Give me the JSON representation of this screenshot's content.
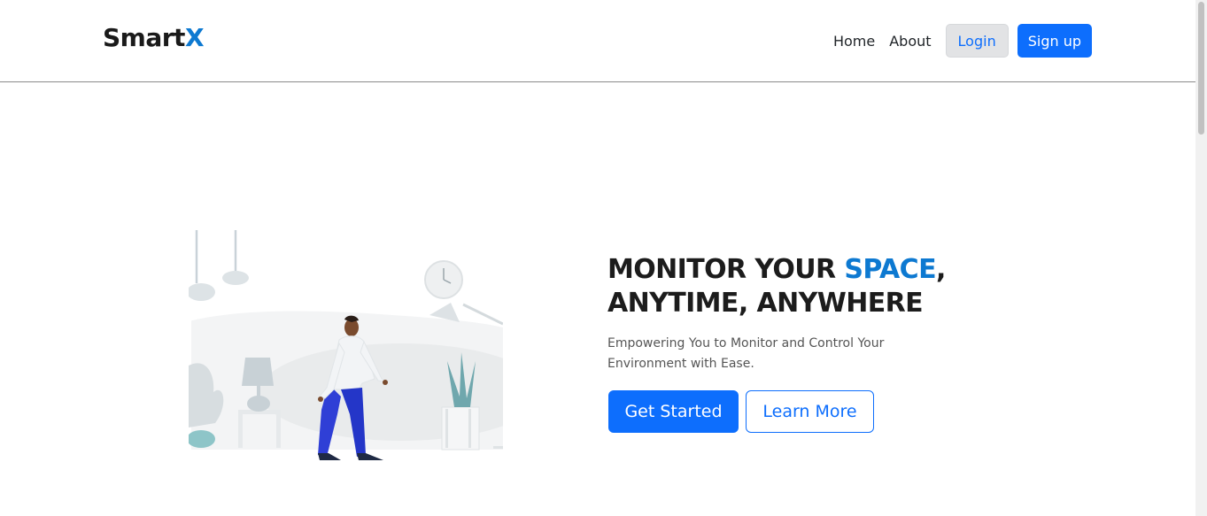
{
  "brand": {
    "name_main": "Smart",
    "name_accent": "X"
  },
  "nav": {
    "home": "Home",
    "about": "About",
    "login": "Login",
    "signup": "Sign up"
  },
  "hero": {
    "title_part1": "MONITOR YOUR ",
    "title_accent": "SPACE",
    "title_part2": ",",
    "title_line2": "ANYTIME, ANYWHERE",
    "subtitle": "Empowering You to Monitor and Control Your Environment with Ease.",
    "primary_button": "Get Started",
    "secondary_button": "Learn More",
    "illustration_icon": "person-walking-room-illustration"
  },
  "colors": {
    "accent": "#0d79d1",
    "primary": "#0d6efd",
    "login_bg": "#e2e3e5"
  }
}
